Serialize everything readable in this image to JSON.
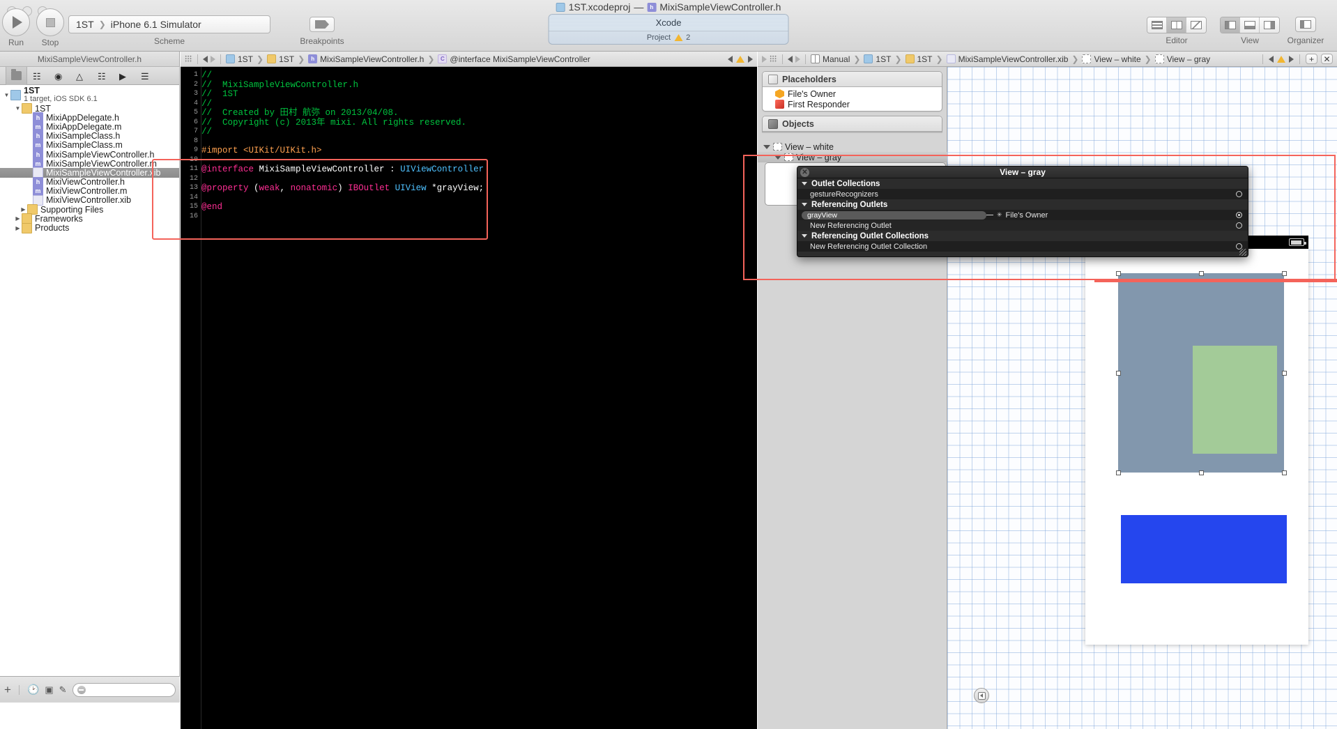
{
  "toolbar": {
    "run_label": "Run",
    "stop_label": "Stop",
    "scheme_label": "Scheme",
    "scheme_project": "1ST",
    "scheme_target": "iPhone 6.1 Simulator",
    "breakpoints_label": "Breakpoints",
    "editor_label": "Editor",
    "view_label": "View",
    "organizer_label": "Organizer",
    "window_title_project": "1ST.xcodeproj",
    "window_title_dash": "—",
    "window_title_file": "MixiSampleViewController.h",
    "activity_title": "Xcode",
    "activity_status": "Project",
    "activity_warning_count": "2"
  },
  "navigator": {
    "title": "MixiSampleViewController.h",
    "tabs": [
      "folder-icon",
      "branch-icon",
      "at-icon",
      "warning-icon",
      "list-icon",
      "tag-icon",
      "bubble-icon"
    ],
    "tree": [
      {
        "label": "1ST",
        "sub": "1 target, iOS SDK 6.1",
        "icon": "proj",
        "indent": 0,
        "disclosure": "open",
        "selected": false
      },
      {
        "label": "1ST",
        "sub": "",
        "icon": "fold",
        "indent": 1,
        "disclosure": "open",
        "selected": false
      },
      {
        "label": "MixiAppDelegate.h",
        "sub": "",
        "icon": "h",
        "indent": 2,
        "disclosure": "",
        "selected": false
      },
      {
        "label": "MixiAppDelegate.m",
        "sub": "",
        "icon": "m",
        "indent": 2,
        "disclosure": "",
        "selected": false
      },
      {
        "label": "MixiSampleClass.h",
        "sub": "",
        "icon": "h",
        "indent": 2,
        "disclosure": "",
        "selected": false
      },
      {
        "label": "MixiSampleClass.m",
        "sub": "",
        "icon": "m",
        "indent": 2,
        "disclosure": "",
        "selected": false
      },
      {
        "label": "MixiSampleViewController.h",
        "sub": "",
        "icon": "h",
        "indent": 2,
        "disclosure": "",
        "selected": false
      },
      {
        "label": "MixiSampleViewController.m",
        "sub": "",
        "icon": "m",
        "indent": 2,
        "disclosure": "",
        "selected": false
      },
      {
        "label": "MixiSampleViewController.xib",
        "sub": "",
        "icon": "xib",
        "indent": 2,
        "disclosure": "",
        "selected": true
      },
      {
        "label": "MixiViewController.h",
        "sub": "",
        "icon": "h",
        "indent": 2,
        "disclosure": "",
        "selected": false
      },
      {
        "label": "MixiViewController.m",
        "sub": "",
        "icon": "m",
        "indent": 2,
        "disclosure": "",
        "selected": false
      },
      {
        "label": "MixiViewController.xib",
        "sub": "",
        "icon": "xib",
        "indent": 2,
        "disclosure": "",
        "selected": false
      },
      {
        "label": "Supporting Files",
        "sub": "",
        "icon": "fold",
        "indent": 1.5,
        "disclosure": "closed",
        "selected": false
      },
      {
        "label": "Frameworks",
        "sub": "",
        "icon": "fold",
        "indent": 1,
        "disclosure": "closed",
        "selected": false
      },
      {
        "label": "Products",
        "sub": "",
        "icon": "fold",
        "indent": 1,
        "disclosure": "closed",
        "selected": false
      }
    ],
    "filter_placeholder": ""
  },
  "editor": {
    "breadcrumb": [
      {
        "label": "1ST",
        "icon": "proj"
      },
      {
        "label": "1ST",
        "icon": "fold"
      },
      {
        "label": "MixiSampleViewController.h",
        "icon": "h"
      },
      {
        "label": "@interface MixiSampleViewController",
        "icon": "cls"
      }
    ],
    "line_numbers": [
      "1",
      "2",
      "3",
      "4",
      "5",
      "6",
      "7",
      "8",
      "9",
      "10",
      "11",
      "12",
      "13",
      "14",
      "15",
      "16"
    ],
    "code_lines": [
      [
        {
          "t": "//",
          "c": "cm"
        }
      ],
      [
        {
          "t": "//  MixiSampleViewController.h",
          "c": "cm"
        }
      ],
      [
        {
          "t": "//  1ST",
          "c": "cm"
        }
      ],
      [
        {
          "t": "//",
          "c": "cm"
        }
      ],
      [
        {
          "t": "//  Created by 田村 航弥 on 2013/04/08.",
          "c": "cm"
        }
      ],
      [
        {
          "t": "//  Copyright (c) 2013年 mixi. All rights reserved.",
          "c": "cm"
        }
      ],
      [
        {
          "t": "//",
          "c": "cm"
        }
      ],
      [
        {
          "t": "",
          "c": "pl"
        }
      ],
      [
        {
          "t": "#import <UIKit/UIKit.h>",
          "c": "pp"
        }
      ],
      [
        {
          "t": "",
          "c": "pl"
        }
      ],
      [
        {
          "t": "@interface ",
          "c": "kw"
        },
        {
          "t": "MixiSampleViewController",
          "c": "pl"
        },
        {
          "t": " : ",
          "c": "pl"
        },
        {
          "t": "UIViewController",
          "c": "ty"
        }
      ],
      [
        {
          "t": "",
          "c": "pl"
        }
      ],
      [
        {
          "t": "@property ",
          "c": "kw"
        },
        {
          "t": "(",
          "c": "pl"
        },
        {
          "t": "weak",
          "c": "kw"
        },
        {
          "t": ", ",
          "c": "pl"
        },
        {
          "t": "nonatomic",
          "c": "kw"
        },
        {
          "t": ") ",
          "c": "pl"
        },
        {
          "t": "IBOutlet ",
          "c": "kw"
        },
        {
          "t": "UIView",
          "c": "ty"
        },
        {
          "t": " *grayView;",
          "c": "pl"
        }
      ],
      [
        {
          "t": "",
          "c": "pl"
        }
      ],
      [
        {
          "t": "@end",
          "c": "kw"
        }
      ],
      [
        {
          "t": "",
          "c": "pl"
        }
      ]
    ]
  },
  "ib": {
    "breadcrumb": [
      {
        "label": "Manual",
        "icon": "man"
      },
      {
        "label": "1ST",
        "icon": "proj"
      },
      {
        "label": "1ST",
        "icon": "fold"
      },
      {
        "label": "MixiSampleViewController.xib",
        "icon": "xib"
      },
      {
        "label": "View – white",
        "icon": "view"
      },
      {
        "label": "View – gray",
        "icon": "view"
      }
    ],
    "placeholders_title": "Placeholders",
    "placeholders": [
      {
        "label": "File's Owner",
        "icon": "hex-icon"
      },
      {
        "label": "First Responder",
        "icon": "cube-icon"
      }
    ],
    "objects_title": "Objects",
    "objects": [
      {
        "label": "View – white",
        "indent": 1,
        "disclosure": "open"
      },
      {
        "label": "View – gray",
        "indent": 2,
        "disclosure": "open"
      }
    ],
    "filter_placeholder": ""
  },
  "connections_popup": {
    "title": "View – gray",
    "close_label": "✕",
    "sections": [
      {
        "header": "Outlet Collections",
        "rows": [
          {
            "label": "gestureRecognizers",
            "connected": false,
            "target": null
          }
        ]
      },
      {
        "header": "Referencing Outlets",
        "rows": [
          {
            "label": "grayView",
            "connected": true,
            "target": "File's Owner"
          },
          {
            "label": "New Referencing Outlet",
            "connected": false,
            "target": null
          }
        ]
      },
      {
        "header": "Referencing Outlet Collections",
        "rows": [
          {
            "label": "New Referencing Outlet Collection",
            "connected": false,
            "target": null
          }
        ]
      }
    ]
  },
  "canvas": {
    "device_width": "320",
    "device_height": "568",
    "views": [
      {
        "name": "View – gray",
        "color": "#8297ad",
        "selected": true
      },
      {
        "name": "View – green",
        "color": "#a3cb98",
        "selected": false
      },
      {
        "name": "View – blue",
        "color": "#2546ee",
        "selected": false
      }
    ]
  },
  "colors": {
    "highlight_red": "#f4635a",
    "gray_view": "#8297ad",
    "green_view": "#a3cb98",
    "blue_view": "#2546ee",
    "code_comment": "#00c53f",
    "code_keyword": "#ff2e94",
    "code_type": "#4fc1ff",
    "code_preprocessor": "#ffa14f"
  }
}
